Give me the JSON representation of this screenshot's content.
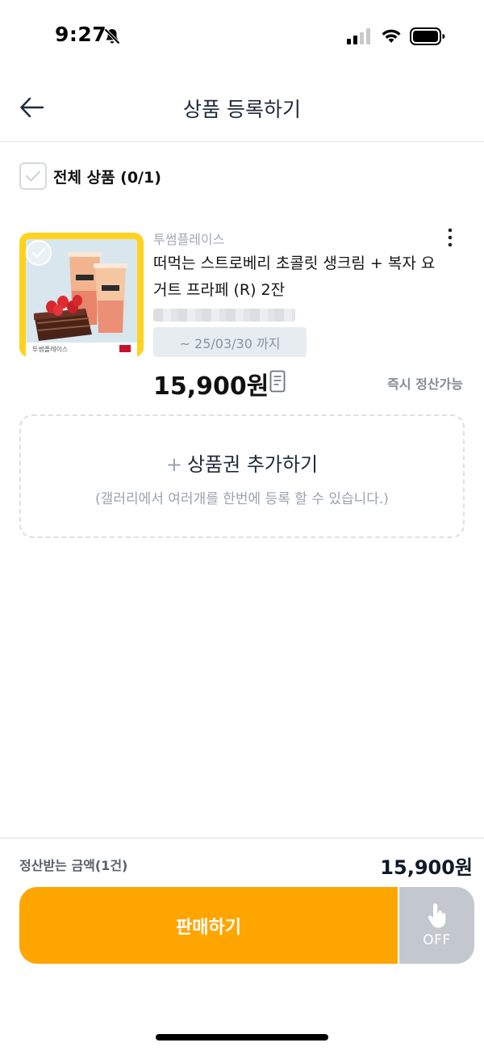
{
  "status_bar": {
    "time": "9:27"
  },
  "header": {
    "title": "상품 등록하기"
  },
  "select_all": {
    "label": "전체 상품 (0/1)"
  },
  "product": {
    "brand": "투썸플레이스",
    "name": "떠먹는 스트로베리 초콜릿 생크림 + 복자 요거트 프라페 (R) 2잔",
    "thumbnail_brand": "투썸플레이스",
    "expiry": "~ 25/03/30 까지",
    "price": "15,900원",
    "settle_badge": "즉시 정산가능"
  },
  "add_voucher": {
    "title": "상품권 추가하기",
    "description": "(갤러리에서 여러개를 한번에 등록 할 수 있습니다.)"
  },
  "summary": {
    "amount_label": "정산받는 금액(1건)",
    "amount_value": "15,900원"
  },
  "actions": {
    "sell_label": "판매하기",
    "toggle_label": "OFF"
  },
  "colors": {
    "accent": "#ffa500",
    "toggle_off": "#c3c8ce",
    "thumbnail_frame": "#ffd21f"
  }
}
